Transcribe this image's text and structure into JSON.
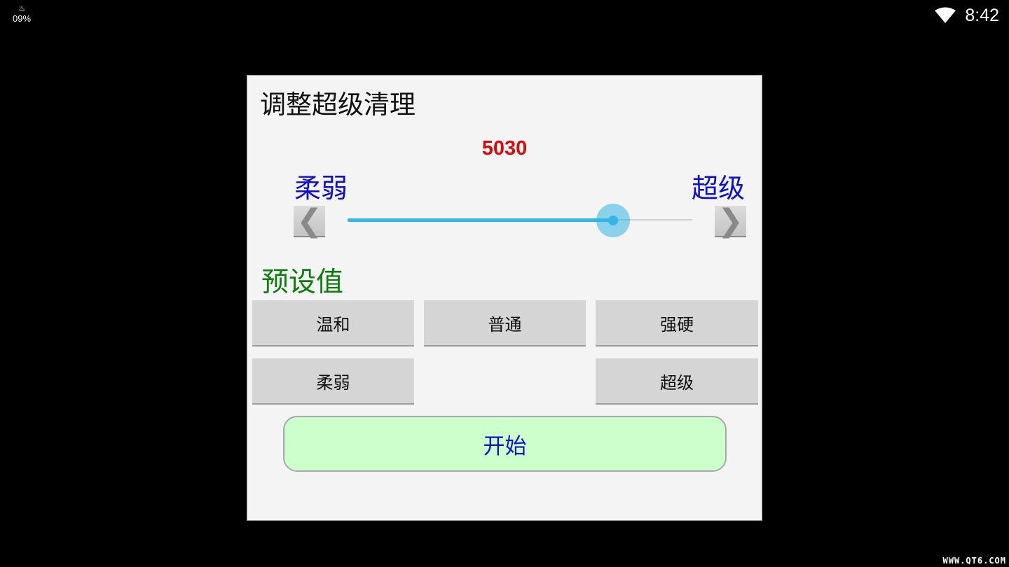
{
  "status_bar": {
    "battery_icon": "flame-icon",
    "battery_text": "09%",
    "wifi_icon": "wifi-icon",
    "time": "8:42"
  },
  "dialog": {
    "title": "调整超级清理",
    "slider": {
      "value_text": "5030",
      "left_label": "柔弱",
      "right_label": "超级",
      "decrease_icon": "chevron-left-icon",
      "increase_icon": "chevron-right-icon",
      "position_fraction": 0.77
    },
    "presets_label": "预设值",
    "presets": {
      "mild": "温和",
      "normal": "普通",
      "strong": "强硬",
      "weak": "柔弱",
      "super": "超级"
    },
    "start_button": "开始"
  },
  "watermark": "WWW.QT6.COM",
  "colors": {
    "value": "#d80b0b",
    "range_labels": "#1010c8",
    "preset_label": "#0c7d0c",
    "slider_accent": "#33b5e5",
    "start_button_bg": "#ccffcc"
  }
}
